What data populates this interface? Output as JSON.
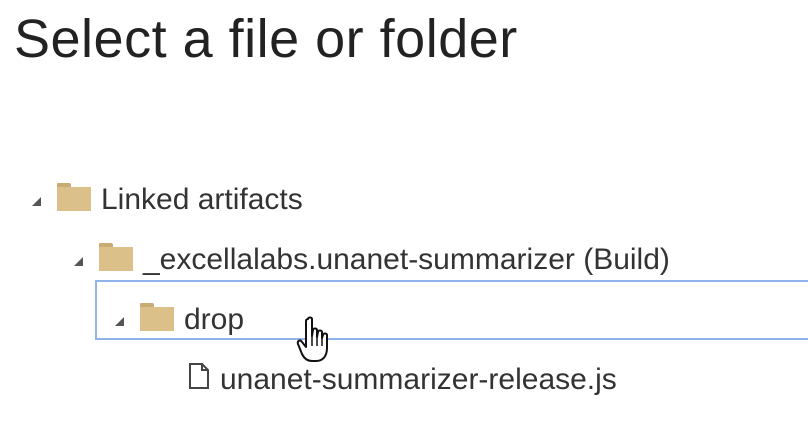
{
  "dialog": {
    "title": "Select a file or folder"
  },
  "tree": {
    "root": {
      "label": "Linked artifacts",
      "icon": "folder-icon",
      "expanded": true
    },
    "build": {
      "label": "_excellalabs.unanet-summarizer (Build)",
      "icon": "folder-icon",
      "expanded": true
    },
    "drop": {
      "label": "drop",
      "icon": "folder-icon",
      "expanded": true,
      "selected": true
    },
    "file": {
      "label": "unanet-summarizer-release.js",
      "icon": "file-icon"
    }
  },
  "colors": {
    "folder": "#dcc08a",
    "selection_border": "#8fb3ea",
    "text": "#333333"
  }
}
